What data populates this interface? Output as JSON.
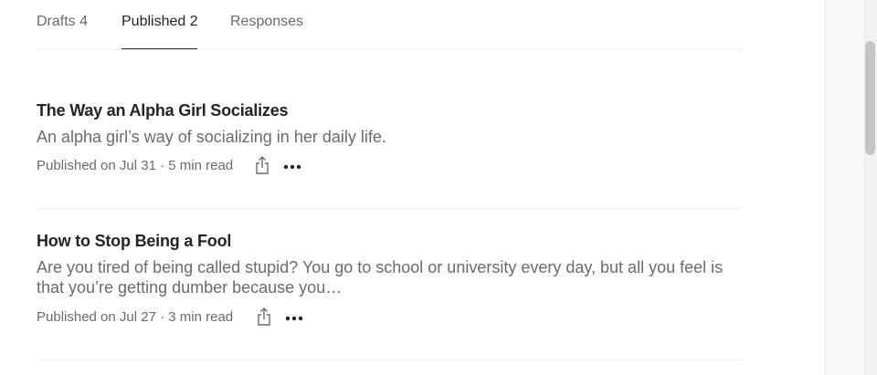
{
  "tabs": [
    {
      "label": "Drafts 4",
      "active": false
    },
    {
      "label": "Published 2",
      "active": true
    },
    {
      "label": "Responses",
      "active": false
    }
  ],
  "stories": [
    {
      "title": "The Way an Alpha Girl Socializes",
      "description": "An alpha girl’s way of socializing in her daily life.",
      "meta": "Published on Jul 31 · 5 min read",
      "share_icon": "share-icon",
      "more_icon": "more-options-icon"
    },
    {
      "title": "How to Stop Being a Fool",
      "description": "Are you tired of being called stupid? You go to school or university every day, but all you feel is that you’re getting dumber because you…",
      "meta": "Published on Jul 27 · 3 min read",
      "share_icon": "share-icon",
      "more_icon": "more-options-icon"
    }
  ],
  "colors": {
    "primary_text": "#242424",
    "secondary_text": "#6b6b6b",
    "divider": "#f0f0f0"
  }
}
